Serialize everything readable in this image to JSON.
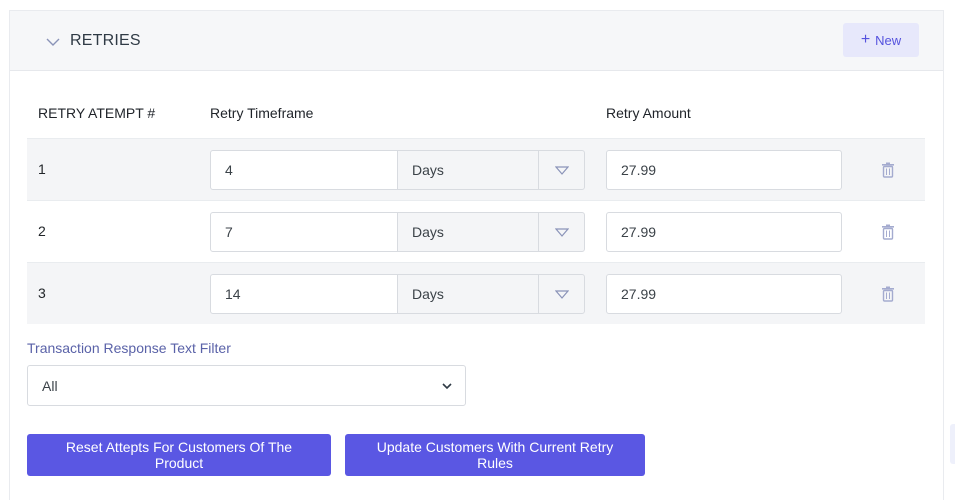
{
  "section": {
    "title": "RETRIES",
    "new_button_label": "New"
  },
  "table": {
    "headers": [
      "RETRY ATEMPT #",
      "Retry Timeframe",
      "Retry Amount"
    ],
    "rows": [
      {
        "attempt": "1",
        "timeframe": "4",
        "unit": "Days",
        "amount": "27.99"
      },
      {
        "attempt": "2",
        "timeframe": "7",
        "unit": "Days",
        "amount": "27.99"
      },
      {
        "attempt": "3",
        "timeframe": "14",
        "unit": "Days",
        "amount": "27.99"
      }
    ]
  },
  "filter": {
    "label": "Transaction Response Text Filter",
    "selected": "All"
  },
  "actions": {
    "reset_label": "Reset Attepts For Customers Of The Product",
    "update_label": "Update Customers With Current Retry Rules"
  },
  "icons": {
    "collapse": "chevron-down-icon",
    "add": "plus-icon",
    "delete": "trash-icon",
    "dropdown": "caret-down-icon"
  },
  "colors": {
    "accent": "#5a57e3",
    "new_button_bg": "#e7e8fb",
    "header_bg": "#f6f7f9",
    "row_shade": "#f4f5f7",
    "icon_muted": "#9aa3c7"
  }
}
